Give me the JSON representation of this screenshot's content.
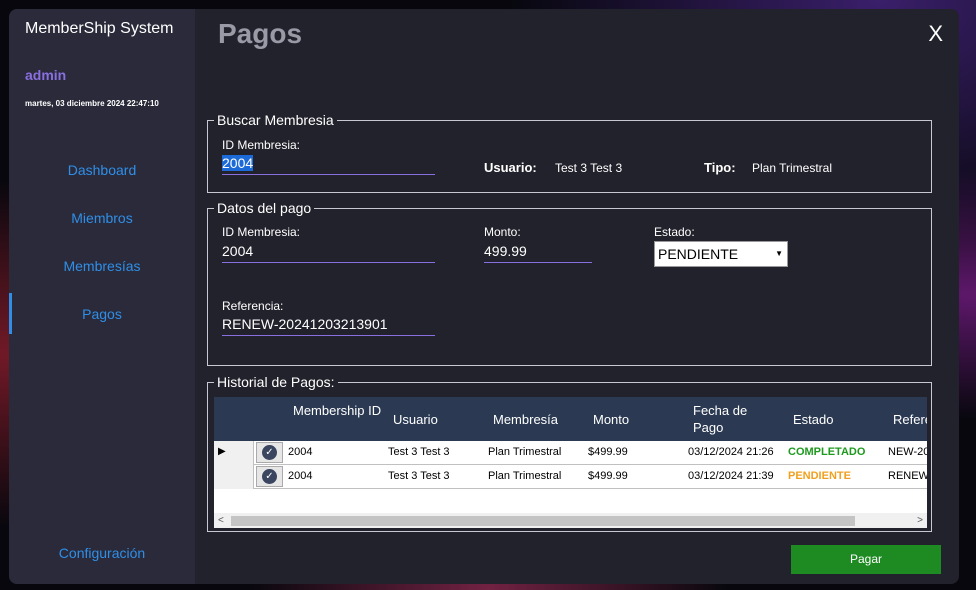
{
  "app": {
    "title": "MemberShip System",
    "user": "admin",
    "datetime": "martes, 03 diciembre 2024 22:47:10"
  },
  "nav": {
    "dashboard": "Dashboard",
    "miembros": "Miembros",
    "membresias": "Membresías",
    "pagos": "Pagos",
    "config": "Configuración"
  },
  "page": {
    "title": "Pagos",
    "close": "X"
  },
  "buscar": {
    "legend": "Buscar Membresia",
    "id_label": "ID Membresia:",
    "id_value": "2004",
    "usuario_label": "Usuario:",
    "usuario_value": "Test 3 Test 3",
    "tipo_label": "Tipo:",
    "tipo_value": "Plan Trimestral"
  },
  "datos": {
    "legend": "Datos del pago",
    "id_label": "ID Membresia:",
    "id_value": "2004",
    "monto_label": "Monto:",
    "monto_value": "499.99",
    "estado_label": "Estado:",
    "estado_value": "PENDIENTE",
    "ref_label": "Referencia:",
    "ref_value": "RENEW-20241203213901"
  },
  "historial": {
    "legend": "Historial de Pagos:",
    "headers": [
      "Membership ID",
      "Usuario",
      "Membresía",
      "Monto",
      "Fecha de Pago",
      "Estado",
      "Refere"
    ],
    "rows": [
      {
        "id": "2004",
        "usuario": "Test 3 Test 3",
        "membresia": "Plan Trimestral",
        "monto": "$499.99",
        "fecha": "03/12/2024 21:26",
        "estado": "COMPLETADO",
        "ref": "NEW-20"
      },
      {
        "id": "2004",
        "usuario": "Test 3 Test 3",
        "membresia": "Plan Trimestral",
        "monto": "$499.99",
        "fecha": "03/12/2024 21:39",
        "estado": "PENDIENTE",
        "ref": "RENEW"
      }
    ]
  },
  "colors": {
    "completado": "#1e9a1e",
    "pendiente": "#f0a020",
    "accent": "#8a6fe0",
    "nav": "#2f8fe8"
  },
  "actions": {
    "pagar": "Pagar"
  }
}
